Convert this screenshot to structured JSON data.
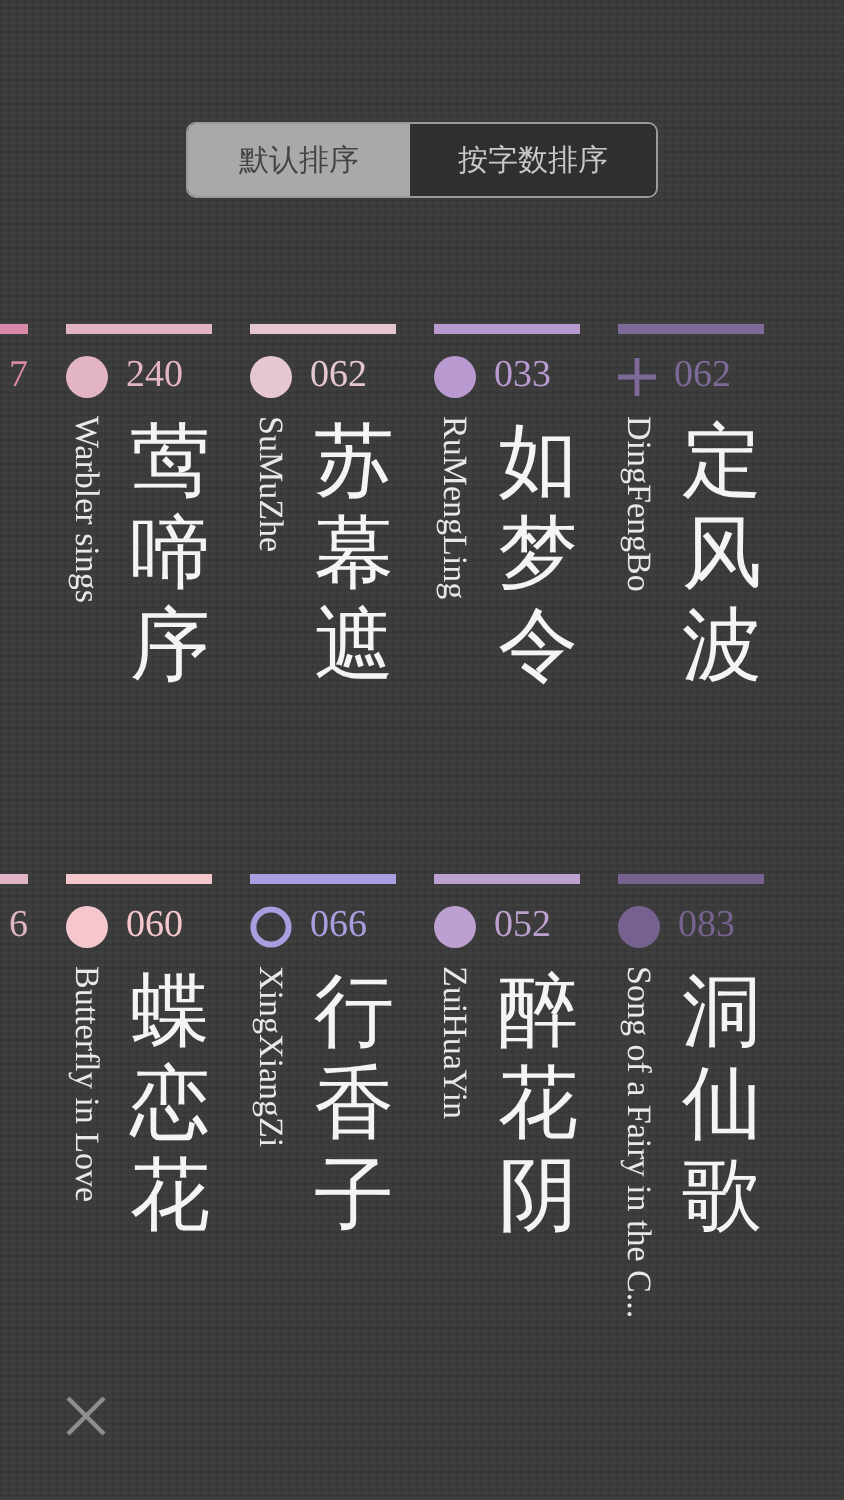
{
  "sort_options": [
    {
      "label": "默认排序",
      "selected": true
    },
    {
      "label": "按字数排序",
      "selected": false
    }
  ],
  "shelves": [
    {
      "cards": [
        {
          "color": "#d98aaa",
          "kind": "none",
          "number": "7"
        },
        {
          "color": "#e3b3c6",
          "kind": "dot",
          "number": "240",
          "latin": "Warbler sings",
          "title": "莺啼序"
        },
        {
          "color": "#e6c6d3",
          "kind": "dot",
          "number": "062",
          "latin": "SuMuZhe",
          "title": "苏幕遮"
        },
        {
          "color": "#b89ad0",
          "kind": "dot",
          "number": "033",
          "latin": "RuMengLing",
          "title": "如梦令"
        },
        {
          "color": "#7e6a98",
          "kind": "plus",
          "number": "062",
          "latin": "DingFengBo",
          "title": "定风波"
        }
      ]
    },
    {
      "cards": [
        {
          "color": "#e0b4c6",
          "kind": "none",
          "number": "6"
        },
        {
          "color": "#f5c6cc",
          "kind": "dot",
          "number": "060",
          "latin": "Butterfly in Love",
          "title": "蝶恋花"
        },
        {
          "color": "#a99ee0",
          "kind": "ring",
          "number": "066",
          "latin": "XingXiangZi",
          "title": "行香子"
        },
        {
          "color": "#bca0d0",
          "kind": "dot",
          "number": "052",
          "latin": "ZuiHuaYin",
          "title": "醉花阴"
        },
        {
          "color": "#77628f",
          "kind": "dot",
          "number": "083",
          "latin": "Song of a Fairy in the C...",
          "title": "洞仙歌"
        }
      ]
    }
  ]
}
